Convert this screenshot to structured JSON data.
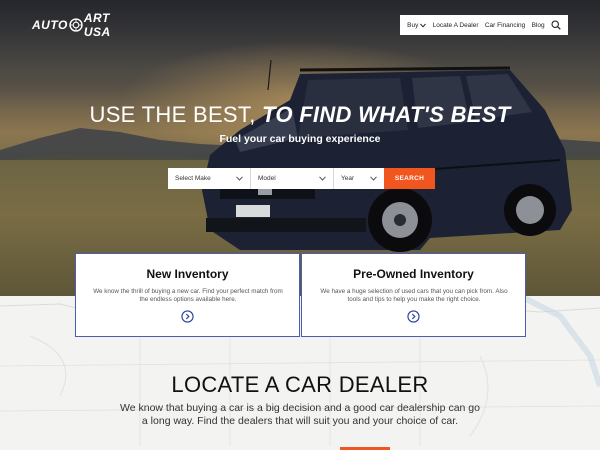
{
  "brand": {
    "logo_left": "AUTO",
    "logo_right": "ART USA",
    "accent": "#f1561f",
    "border_accent": "#4a5eb0"
  },
  "nav": {
    "items": [
      {
        "label": "Buy",
        "has_dropdown": true
      },
      {
        "label": "Locate A Dealer"
      },
      {
        "label": "Car Financing"
      },
      {
        "label": "Blog"
      }
    ],
    "search_icon": "search-icon"
  },
  "hero": {
    "headline_a": "USE THE BEST, ",
    "headline_b": "TO FIND WHAT'S BEST",
    "subhead": "Fuel your car buying experience"
  },
  "search": {
    "make_value": "Select Make",
    "model_value": "Model",
    "year_value": "Year",
    "button_label": "SEARCH"
  },
  "cards": [
    {
      "title": "New Inventory",
      "desc": "We know the thrill of buying a new car. Find your perfect match from the endless options available here.",
      "icon": "arrow-right-circle-icon"
    },
    {
      "title": "Pre-Owned Inventory",
      "desc": "We have  a huge selection of used cars that you can pick from. Also tools and tips to help you make the right choice.",
      "icon": "arrow-right-circle-icon"
    }
  ],
  "locate": {
    "title": "LOCATE A CAR DEALER",
    "desc": "We know that buying a car is a big decision and a good car dealership can go a long way. Find the dealers that will suit you and your choice of car."
  }
}
